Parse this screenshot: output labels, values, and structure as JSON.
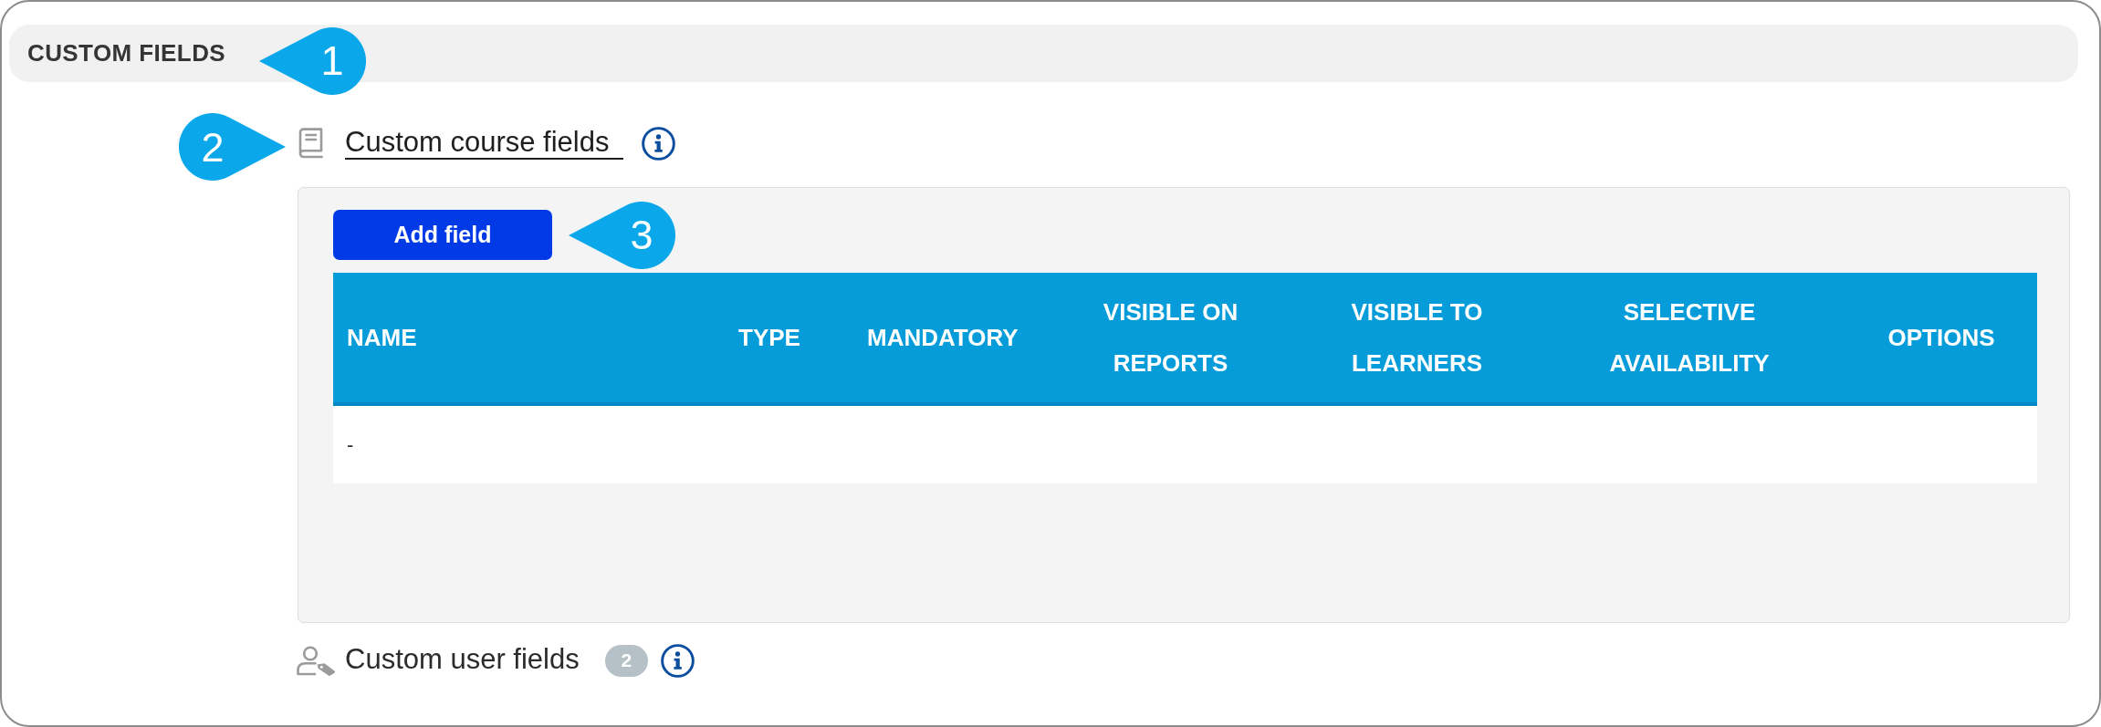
{
  "section": {
    "title": "CUSTOM FIELDS",
    "callout": {
      "number": "1"
    }
  },
  "field_groups": [
    {
      "kind": "course",
      "label": "Custom course fields",
      "expanded": true,
      "callout": {
        "number": "2"
      },
      "add_button": {
        "label": "Add field",
        "callout": {
          "number": "3"
        }
      },
      "table": {
        "columns": [
          "NAME",
          "TYPE",
          "MANDATORY",
          "VISIBLE ON REPORTS",
          "VISIBLE TO LEARNERS",
          "SELECTIVE AVAILABILITY",
          "OPTIONS"
        ],
        "rows": [
          {
            "cells": [
              "-"
            ]
          }
        ]
      }
    },
    {
      "kind": "user",
      "label": "Custom user fields",
      "expanded": false,
      "count": "2"
    }
  ]
}
